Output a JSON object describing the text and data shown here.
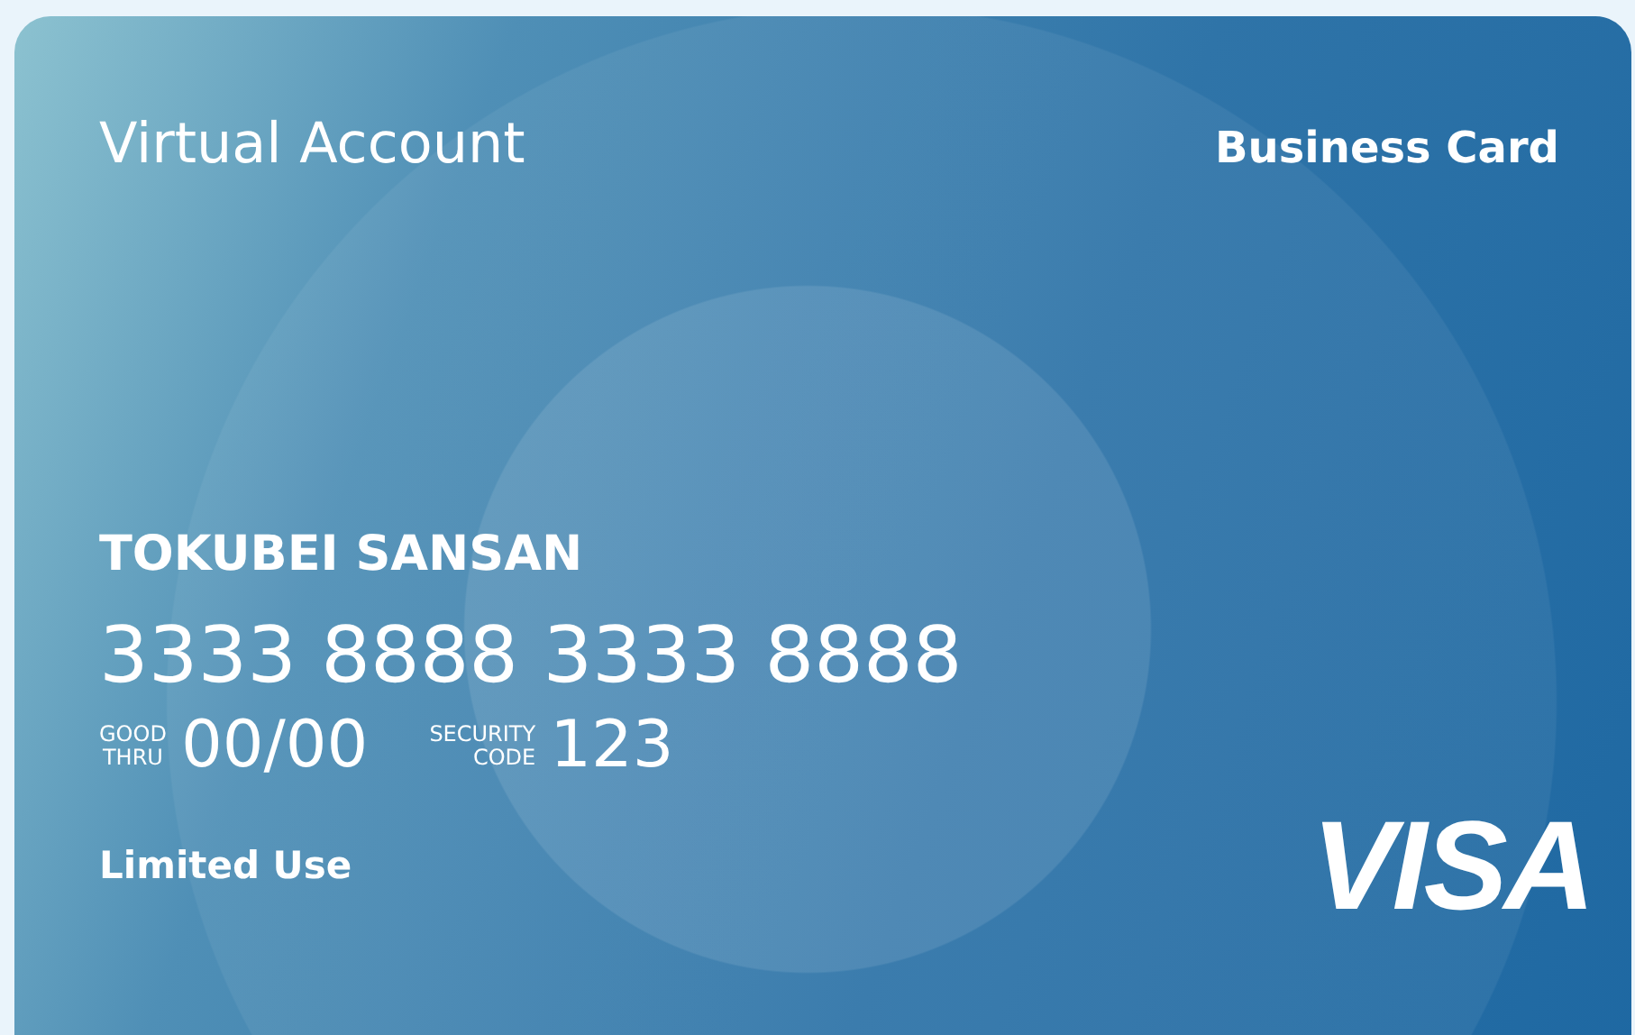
{
  "card": {
    "title": "Virtual Account",
    "card_type": "Business Card",
    "holder": "TOKUBEI SANSAN",
    "number": "3333 8888 3333 8888",
    "expiry": {
      "label_top": "GOOD",
      "label_bottom": "THRU",
      "value": "00/00"
    },
    "security": {
      "label_top": "SECURITY",
      "label_bottom": "CODE",
      "value": "123"
    },
    "usage": "Limited Use",
    "brand": "VISA"
  }
}
